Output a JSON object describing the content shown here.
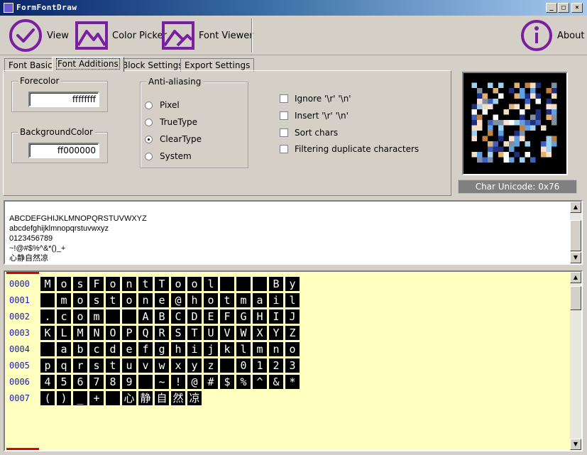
{
  "window": {
    "title": "FormFontDraw",
    "minimize": "_",
    "maximize": "□",
    "close": "×"
  },
  "toolbar": {
    "view_label": "View",
    "color_picker_label": "Color Picker",
    "font_viewer_label": "Font Viewer",
    "about_label": "About",
    "accent": "#7b1fa2"
  },
  "tabs": [
    "Font Basic",
    "Font Additions",
    "Block Settings",
    "Export Settings"
  ],
  "forecolor": {
    "label": "Forecolor",
    "value": "ffffffff"
  },
  "backcolor": {
    "label": "BackgroundColor",
    "value": "ff000000"
  },
  "antialias": {
    "label": "Anti-aliasing",
    "options": [
      "Pixel",
      "TrueType",
      "ClearType",
      "System"
    ],
    "selected": "ClearType"
  },
  "checks": [
    "Ignore '\\r' '\\n'",
    "Insert '\\r' '\\n'",
    "Sort chars",
    "Filtering duplicate characters"
  ],
  "char_unicode": "Char Unicode: 0x76",
  "sample": {
    "lines": [
      "ABCDEFGHIJKLMNOPQRSTUVWXYZ",
      "abcdefghijklmnopqrstuvwxyz",
      "0123456789",
      "~!@#$%^&*()_+",
      "心静自然凉"
    ]
  },
  "grid": {
    "rows": [
      {
        "label": "0000",
        "cells": [
          "M",
          "o",
          "s",
          "F",
          "o",
          "n",
          "t",
          "T",
          "o",
          "o",
          "l",
          "",
          "",
          "",
          "B",
          "y"
        ]
      },
      {
        "label": "0001",
        "cells": [
          "",
          "m",
          "o",
          "s",
          "t",
          "o",
          "n",
          "e",
          "@",
          "h",
          "o",
          "t",
          "m",
          "a",
          "i",
          "l"
        ]
      },
      {
        "label": "0002",
        "cells": [
          ".",
          "c",
          "o",
          "m",
          "",
          "",
          "A",
          "B",
          "C",
          "D",
          "E",
          "F",
          "G",
          "H",
          "I",
          "J"
        ]
      },
      {
        "label": "0003",
        "cells": [
          "K",
          "L",
          "M",
          "N",
          "O",
          "P",
          "Q",
          "R",
          "S",
          "T",
          "U",
          "V",
          "W",
          "X",
          "Y",
          "Z"
        ]
      },
      {
        "label": "0004",
        "cells": [
          "",
          "a",
          "b",
          "c",
          "d",
          "e",
          "f",
          "g",
          "h",
          "i",
          "j",
          "k",
          "l",
          "m",
          "n",
          "o"
        ]
      },
      {
        "label": "0005",
        "cells": [
          "p",
          "q",
          "r",
          "s",
          "t",
          "u",
          "v",
          "w",
          "x",
          "y",
          "z",
          "",
          "0",
          "1",
          "2",
          "3"
        ]
      },
      {
        "label": "0006",
        "cells": [
          "4",
          "5",
          "6",
          "7",
          "8",
          "9",
          "",
          "~",
          "!",
          "@",
          "#",
          "$",
          "%",
          "^",
          "&",
          "*"
        ]
      },
      {
        "label": "0007",
        "cells": [
          "(",
          ")",
          "_",
          "+",
          "",
          "心",
          "静",
          "自",
          "然",
          "凉"
        ]
      }
    ]
  }
}
